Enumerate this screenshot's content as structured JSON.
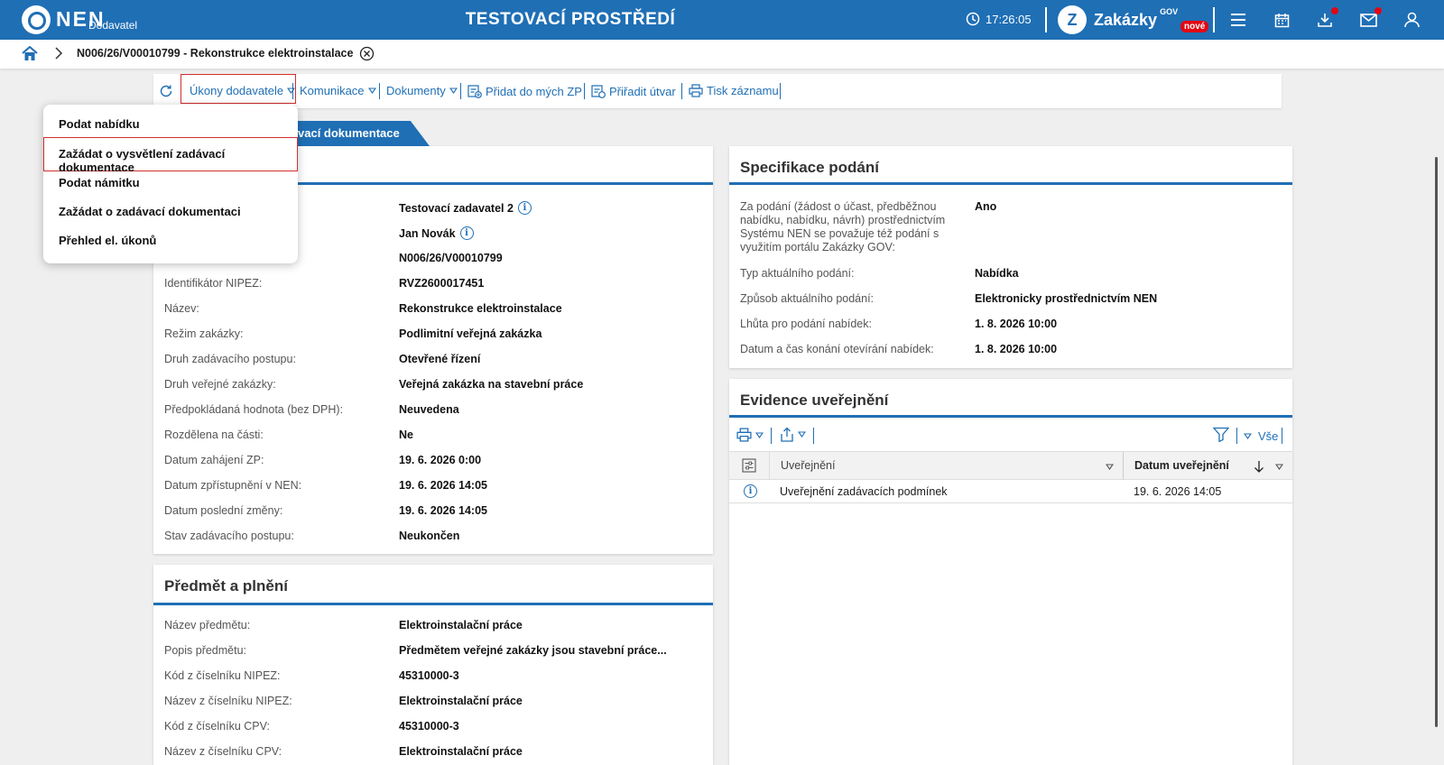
{
  "header": {
    "logo": "NEN",
    "logo_sub": "Dodavatel",
    "env_title": "TESTOVACÍ PROSTŘEDÍ",
    "time": "17:26:05",
    "gov_name": "Zakázky",
    "gov_sup": "GOV",
    "gov_badge": "nové"
  },
  "breadcrumb": {
    "text": "N006/26/V00010799 - Rekonstrukce elektroinstalace"
  },
  "toolbar": {
    "ukony": "Úkony dodavatele",
    "komunikace": "Komunikace",
    "dokumenty": "Dokumenty",
    "pridat": "Přidat do mých ZP",
    "priradit": "Přiřadit útvar",
    "tisk": "Tisk záznamu"
  },
  "tab": {
    "label": "vací dokumentace"
  },
  "dropdown": {
    "items": [
      "Podat nabídku",
      "Zažádat o vysvětlení zadávací dokumentace",
      "Podat námitku",
      "Zažádat o zadávací dokumentaci",
      "Přehled el. úkonů"
    ]
  },
  "detail": {
    "rows": [
      {
        "label": "",
        "value": "Testovací zadavatel 2"
      },
      {
        "label": "",
        "value": "Jan Novák"
      },
      {
        "label": "",
        "value": "N006/26/V00010799"
      },
      {
        "label": "Identifikátor NIPEZ:",
        "value": "RVZ2600017451"
      },
      {
        "label": "Název:",
        "value": "Rekonstrukce elektroinstalace"
      },
      {
        "label": "Režim zakázky:",
        "value": "Podlimitní veřejná zakázka"
      },
      {
        "label": "Druh zadávacího postupu:",
        "value": "Otevřené řízení"
      },
      {
        "label": "Druh veřejné zakázky:",
        "value": "Veřejná zakázka na stavební práce"
      },
      {
        "label": "Předpokládaná hodnota (bez DPH):",
        "value": "Neuvedena"
      },
      {
        "label": "Rozdělena na části:",
        "value": "Ne"
      },
      {
        "label": "Datum zahájení ZP:",
        "value": "19. 6. 2026 0:00"
      },
      {
        "label": "Datum zpřístupnění v NEN:",
        "value": "19. 6. 2026 14:05"
      },
      {
        "label": "Datum poslední změny:",
        "value": "19. 6. 2026 14:05"
      },
      {
        "label": "Stav zadávacího postupu:",
        "value": "Neukončen"
      }
    ]
  },
  "predmet": {
    "title": "Předmět a plnění",
    "rows": [
      {
        "label": "Název předmětu:",
        "value": "Elektroinstalační práce"
      },
      {
        "label": "Popis předmětu:",
        "value": "Předmětem veřejné zakázky jsou stavební práce..."
      },
      {
        "label": "Kód z číselníku NIPEZ:",
        "value": "45310000-3"
      },
      {
        "label": "Název z číselníku NIPEZ:",
        "value": "Elektroinstalační práce"
      },
      {
        "label": "Kód z číselníku CPV:",
        "value": "45310000-3"
      },
      {
        "label": "Název z číselníku CPV:",
        "value": "Elektroinstalační práce"
      }
    ]
  },
  "specifikace": {
    "title": "Specifikace podání",
    "first_label": "Za podání (žádost o účast, předběžnou nabídku, nabídku, návrh) prostřednictvím Systému NEN se považuje též podání s využitím portálu Zakázky GOV:",
    "first_value": "Ano",
    "rows": [
      {
        "label": "Typ aktuálního podání:",
        "value": "Nabídka"
      },
      {
        "label": "Způsob aktuálního podání:",
        "value": "Elektronicky prostřednictvím NEN"
      },
      {
        "label": "Lhůta pro podání nabídek:",
        "value": "1. 8. 2026 10:00"
      },
      {
        "label": "Datum a čas konání otevírání nabídek:",
        "value": "1. 8. 2026 10:00"
      }
    ]
  },
  "evidence": {
    "title": "Evidence uveřejnění",
    "filter_all": "Vše",
    "col_uverejneni": "Uveřejnění",
    "col_datum": "Datum uveřejnění",
    "rows": [
      {
        "name": "Uveřejnění zadávacích podmínek",
        "date": "19. 6. 2026 14:05"
      }
    ]
  }
}
